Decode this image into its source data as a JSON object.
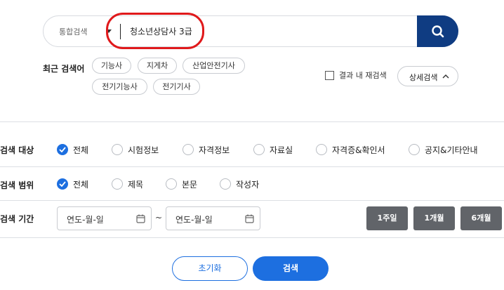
{
  "search": {
    "scope_label": "통합검색",
    "query": "청소년상담사 3급"
  },
  "recent": {
    "label": "최근 검색어",
    "keywords": [
      "기능사",
      "지게차",
      "산업안전기사",
      "전기기능사",
      "전기기사"
    ]
  },
  "options": {
    "within_results_label": "결과 내 재검색",
    "within_results_checked": false,
    "detail_label": "상세검색"
  },
  "filters": {
    "target": {
      "label": "검색 대상",
      "options": [
        "전체",
        "시험정보",
        "자격정보",
        "자료실",
        "자격증&확인서",
        "공지&기타안내"
      ],
      "selected": "전체"
    },
    "scope": {
      "label": "검색 범위",
      "options": [
        "전체",
        "제목",
        "본문",
        "작성자"
      ],
      "selected": "전체"
    },
    "period": {
      "label": "검색 기간",
      "start_placeholder": "연도-월-일",
      "end_placeholder": "연도-월-일",
      "separator": "~",
      "quick": [
        "1주일",
        "1개월",
        "6개월"
      ]
    }
  },
  "actions": {
    "reset_label": "초기화",
    "search_label": "검색"
  },
  "colors": {
    "brand_navy": "#0f3c82",
    "primary_blue": "#1d6fe0",
    "annotation_red": "#e0191b",
    "period_gray": "#616469"
  }
}
